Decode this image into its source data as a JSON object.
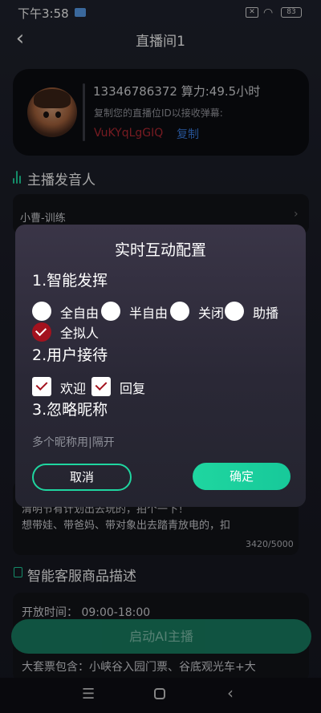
{
  "status_bar": {
    "time": "下午3:58",
    "battery": "83"
  },
  "header": {
    "title": "直播间1"
  },
  "profile": {
    "phone_and_power": "13346786372 算力:49.5小时",
    "copy_tip": "复制您的直播位ID以接收弹幕:",
    "room_id": "VuKYqLgGIQ",
    "copy_label": "复制"
  },
  "voice_section": {
    "title": "主播发音人",
    "selected_voice": "小曹-训练"
  },
  "description": {
    "line1": "清明节有计划出去玩的，拍个一下！",
    "line2": "想带娃、带爸妈、带对象出去踏青放电的，扣",
    "counter": "3420/5000"
  },
  "product_section": {
    "title": "智能客服商品描述",
    "open_time": "开放时间：  09:00-18:00",
    "package": "大套票包含：小峡谷入园门票、谷底观光车+大"
  },
  "start_button": "启动AI主播",
  "dialog": {
    "title": "实时互动配置",
    "section1": "1.智能发挥",
    "options": [
      "全自由",
      "半自由",
      "关闭",
      "助播",
      "全拟人"
    ],
    "selected_option": "全拟人",
    "section2": "2.用户接待",
    "checkboxes": [
      {
        "label": "欢迎",
        "checked": true
      },
      {
        "label": "回复",
        "checked": true
      }
    ],
    "section3": "3.忽略昵称",
    "ignore_placeholder": "多个昵称用|隔开",
    "cancel": "取消",
    "confirm": "确定"
  },
  "colors": {
    "accent": "#1fd6a0",
    "selected_red": "#a3121e",
    "link_blue": "#3a7de0"
  }
}
